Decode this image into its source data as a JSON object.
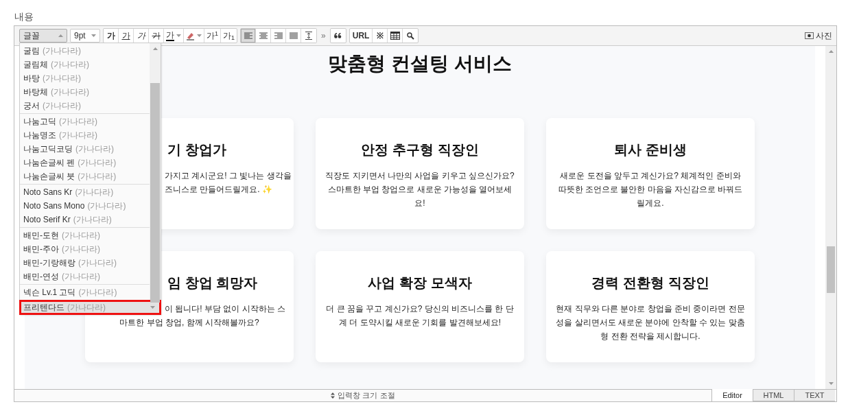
{
  "label": "내용",
  "toolbar": {
    "font_select": "글꼴",
    "size_select": "9pt",
    "format_buttons": [
      {
        "kind": "bold",
        "text": "가"
      },
      {
        "kind": "underline",
        "text": "가"
      },
      {
        "kind": "italic",
        "text": "가"
      },
      {
        "kind": "strike",
        "text": "가"
      },
      {
        "kind": "color",
        "text": "가"
      },
      {
        "kind": "highlight"
      },
      {
        "kind": "plain",
        "text": "가$^{1}$"
      },
      {
        "kind": "plain",
        "text": "가$_{1}$"
      }
    ],
    "align_buttons": [
      {
        "kind": "left",
        "selected": true
      },
      {
        "kind": "center",
        "selected": false
      },
      {
        "kind": "right",
        "selected": false
      },
      {
        "kind": "justify",
        "selected": false
      },
      {
        "kind": "spacing",
        "selected": false
      }
    ],
    "more": "»",
    "insert_buttons": [
      {
        "kind": "quote"
      },
      {
        "kind": "text",
        "text": "URL"
      },
      {
        "kind": "text",
        "text": "※"
      },
      {
        "kind": "table"
      },
      {
        "kind": "search"
      }
    ],
    "photo_button": "사진"
  },
  "font_menu": {
    "groups": [
      [
        {
          "name": "굴림",
          "sample": "(가나다라)",
          "selected": false
        },
        {
          "name": "굴림체",
          "sample": "(가나다라)",
          "selected": false
        },
        {
          "name": "바탕",
          "sample": "(가나다라)",
          "selected": false
        },
        {
          "name": "바탕체",
          "sample": "(가나다라)",
          "selected": false
        },
        {
          "name": "궁서",
          "sample": "(가나다라)",
          "selected": false
        }
      ],
      [
        {
          "name": "나눔고딕",
          "sample": "(가나다라)",
          "selected": false
        },
        {
          "name": "나눔명조",
          "sample": "(가나다라)",
          "selected": false
        },
        {
          "name": "나눔고딕코딩",
          "sample": "(가나다라)",
          "selected": false
        },
        {
          "name": "나눔손글씨 펜",
          "sample": "(가나다라)",
          "selected": false
        },
        {
          "name": "나눔손글씨 붓",
          "sample": "(가나다라)",
          "selected": false
        }
      ],
      [
        {
          "name": "Noto Sans Kr",
          "sample": "(가나다라)",
          "selected": false
        },
        {
          "name": "Noto Sans Mono",
          "sample": "(가나다라)",
          "selected": false
        },
        {
          "name": "Noto Serif Kr",
          "sample": "(가나다라)",
          "selected": false
        }
      ],
      [
        {
          "name": "배민-도현",
          "sample": "(가나다라)",
          "selected": false
        },
        {
          "name": "배민-주아",
          "sample": "(가나다라)",
          "selected": false
        },
        {
          "name": "배민-기랑해랑",
          "sample": "(가나다라)",
          "selected": false
        },
        {
          "name": "배민-연성",
          "sample": "(가나다라)",
          "selected": false
        }
      ],
      [
        {
          "name": "넥슨 Lv.1 고딕",
          "sample": "(가나다라)",
          "selected": false
        }
      ],
      [
        {
          "name": "프리텐다드",
          "sample": "(가나다라)",
          "selected": true
        }
      ]
    ]
  },
  "document": {
    "heading": "맞춤형 컨설팅 서비스",
    "cards": [
      {
        "title": "기 창업가",
        "lines": [
          "가지고 계시군요! 그 빛나는 생각을",
          "즈니스로 만들어드릴게요. ✨"
        ]
      },
      {
        "title": "안정 추구형 직장인",
        "lines": [
          "직장도 지키면서 나만의 사업을 키우고 싶으신가요?",
          "스마트한 부업 창업으로 새로운 가능성을 열어보세",
          "요!"
        ]
      },
      {
        "title": "퇴사 준비생",
        "lines": [
          "새로운 도전을 앞두고 계신가요? 체계적인 준비와",
          "따뜻한 조언으로 불안한 마음을 자신감으로 바꿔드",
          "릴게요."
        ]
      },
      {
        "title": "임 창업 희망자",
        "lines": [
          "이 됩니다! 부담 없이 시작하는 스",
          "마트한 부업 창업, 함께 시작해볼까요?"
        ]
      },
      {
        "title": "사업 확장 모색자",
        "lines": [
          "더 큰 꿈을 꾸고 계신가요? 당신의 비즈니스를 한 단",
          "계 더 도약시킬 새로운 기회를 발견해보세요!"
        ]
      },
      {
        "title": "경력 전환형 직장인",
        "lines": [
          "현재 직무와 다른 분야로 창업을 준비 중이라면 전문",
          "성을 살리면서도 새로운 분야에 안착할 수 있는 맞춤",
          "형 전환 전략을 제시합니다."
        ]
      }
    ]
  },
  "resize_bar": "입력창 크기 조절",
  "mode_tabs": [
    {
      "label": "Editor",
      "selected": true
    },
    {
      "label": "HTML",
      "selected": false
    },
    {
      "label": "TEXT",
      "selected": false
    }
  ]
}
